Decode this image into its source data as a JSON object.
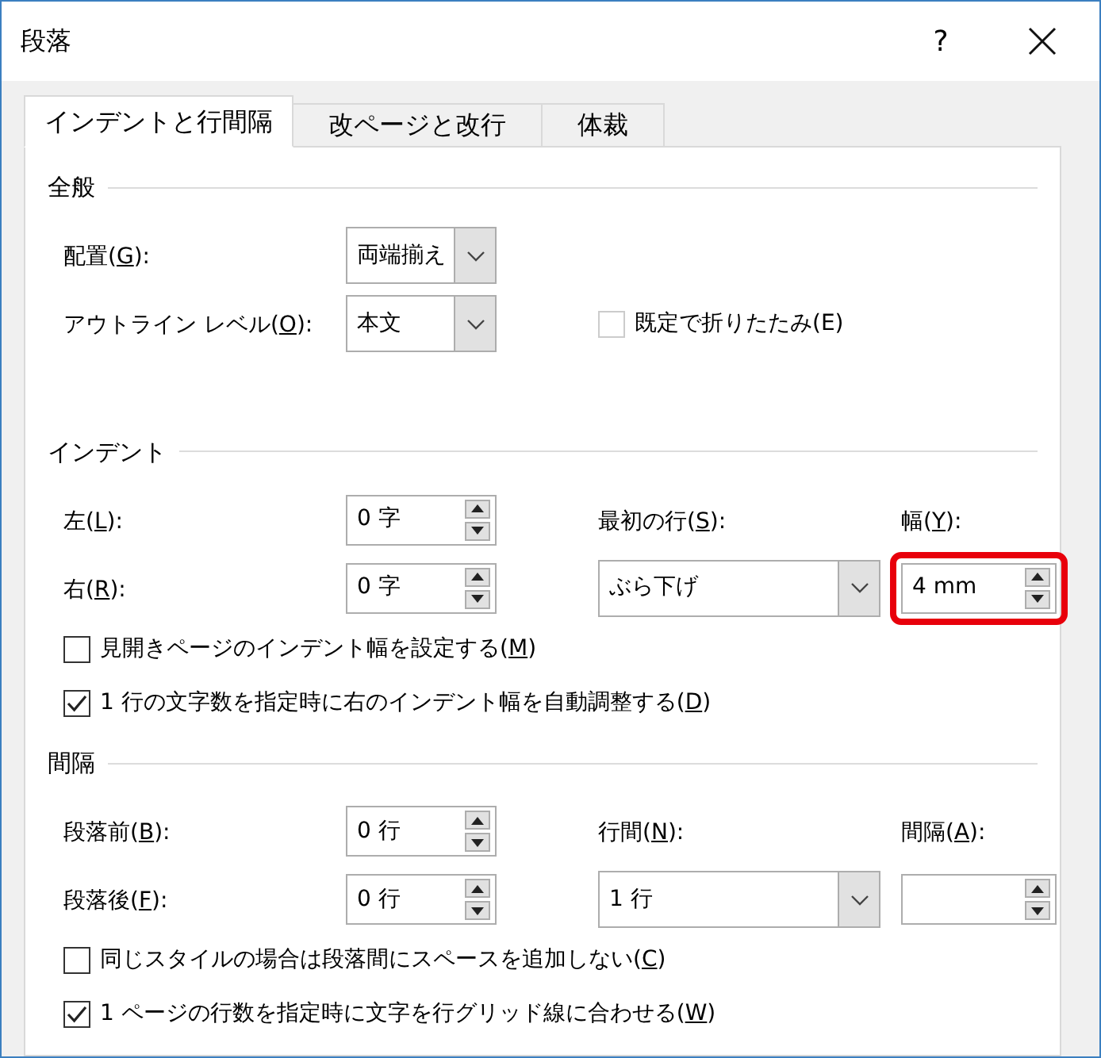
{
  "window": {
    "title": "段落",
    "help": "?"
  },
  "tabs": [
    {
      "label": "インデントと行間隔",
      "selected": true
    },
    {
      "label": "改ページと改行",
      "selected": false
    },
    {
      "label": "体裁",
      "selected": false
    }
  ],
  "sections": [
    {
      "heading": "全般",
      "rows": [
        {
          "label": [
            "配置(",
            "G",
            "):"
          ],
          "field": {
            "kind": "combo",
            "value": "両端揃え"
          }
        },
        {
          "label": [
            "アウトライン レベル(",
            "O",
            "):"
          ],
          "field": {
            "kind": "combo",
            "value": "本文"
          },
          "middle": {
            "kind": "checkbox",
            "label": [
              "既定で折りたたみ(E)"
            ],
            "checked": false,
            "disabled": true
          }
        }
      ]
    },
    {
      "heading": "インデント",
      "rows": [
        {
          "label": [
            "左(",
            "L",
            "):"
          ],
          "field": {
            "kind": "spin",
            "value": "0 字"
          },
          "middle": {
            "kind": "label",
            "label": [
              "最初の行(",
              "S",
              "):"
            ]
          },
          "right": {
            "kind": "label",
            "label": [
              "幅(",
              "Y",
              "):"
            ]
          }
        },
        {
          "label": [
            "右(",
            "R",
            "):"
          ],
          "field": {
            "kind": "spin",
            "value": "0 字"
          },
          "middle": {
            "kind": "combo",
            "value": "ぶら下げ"
          },
          "right": {
            "kind": "spin",
            "value": "4 mm",
            "highlighted": true
          }
        }
      ],
      "checkboxes": [
        {
          "label": [
            "見開きページのインデント幅を設定する(",
            "M",
            ")"
          ],
          "checked": false,
          "disabled": false
        },
        {
          "label": [
            "1 行の文字数を指定時に右のインデント幅を自動調整する(",
            "D",
            ")"
          ],
          "checked": true,
          "disabled": false
        }
      ]
    },
    {
      "heading": "間隔",
      "rows": [
        {
          "label": [
            "段落前(",
            "B",
            "):"
          ],
          "field": {
            "kind": "spin",
            "value": "0 行"
          },
          "middle": {
            "kind": "label",
            "label": [
              "行間(",
              "N",
              "):"
            ]
          },
          "right": {
            "kind": "label",
            "label": [
              "間隔(",
              "A",
              "):"
            ]
          }
        },
        {
          "label": [
            "段落後(",
            "F",
            "):"
          ],
          "field": {
            "kind": "spin",
            "value": "0 行"
          },
          "middle": {
            "kind": "combo",
            "value": "1 行"
          },
          "right": {
            "kind": "spin",
            "highlighted": false
          }
        }
      ],
      "checkboxes": [
        {
          "label": [
            "同じスタイルの場合は段落間にスペースを追加しない(",
            "C",
            ")"
          ],
          "checked": false,
          "disabled": false
        },
        {
          "label": [
            "1 ページの行数を指定時に文字を行グリッド線に合わせる(",
            "W",
            ")"
          ],
          "checked": true,
          "disabled": false
        }
      ]
    }
  ]
}
